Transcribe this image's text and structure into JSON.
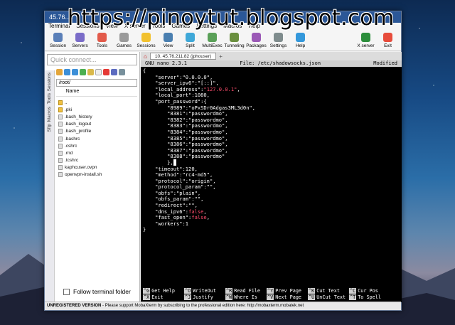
{
  "watermark": "https://pinoytut.blogspot.com",
  "window": {
    "title": "45.76.…"
  },
  "menu": [
    "Terminal",
    "Sessions",
    "View",
    "X server",
    "Tools",
    "Games",
    "Settings",
    "Macros",
    "Help"
  ],
  "toolbar": [
    "Session",
    "Servers",
    "Tools",
    "Games",
    "Sessions",
    "View",
    "Split",
    "MultiExec",
    "Tunneling",
    "Packages",
    "Settings",
    "Help",
    "X server",
    "Exit"
  ],
  "sidebar": {
    "quick_connect": "Quick connect...",
    "tabs": [
      "Sessions",
      "Tools",
      "Macros",
      "Sftp"
    ],
    "path": "/root/",
    "name_header": "Name",
    "files": [
      "..",
      ".pki",
      ".bash_history",
      ".bash_logout",
      ".bash_profile",
      ".bashrc",
      ".cshrc",
      ".rnd",
      ".tcshrc",
      "kaphcuser.ovpn",
      "openvpn-install.sh"
    ],
    "follow": "Follow terminal folder"
  },
  "terminal": {
    "tab": "10. 45.76.211.82 (jphouser)",
    "nano_version": "GNU nano 2.3.1",
    "file": "File: /etc/shadowsocks.json",
    "state": "Modified",
    "lines": [
      "{",
      "    \"server\":\"0.0.0.0\",",
      "    \"server_ipv6\":\"[::]\",",
      "    \"local_address\":\"127.0.0.1\",",
      "    \"local_port\":1080,",
      "    \"port_password\":{",
      "        \"8989\":\"oPxSDr0Adgas3ML3d0n\",",
      "        \"8381\":\"passwordmo\",",
      "        \"8382\":\"passwordmo\",",
      "        \"8383\":\"passwordmo\",",
      "        \"8384\":\"passwordmo\",",
      "        \"8385\":\"passwordmo\",",
      "        \"8386\":\"passwordmo\",",
      "        \"8387\":\"passwordmo\",",
      "        \"8388\":\"passwordmo\"",
      "        },",
      "    \"timeout\":120,",
      "    \"method\":\"rc4-md5\",",
      "    \"protocol\":\"origin\",",
      "    \"protocol_param\":\"\",",
      "    \"obfs\":\"plain\",",
      "    \"obfs_param\":\"\",",
      "    \"redirect\":\"\",",
      "    \"dns_ipv6\":false,",
      "    \"fast_open\":false,",
      "    \"workers\":1",
      "}"
    ],
    "shortcuts_row1": [
      [
        "^G",
        "Get Help"
      ],
      [
        "^O",
        "WriteOut"
      ],
      [
        "^R",
        "Read File"
      ],
      [
        "^Y",
        "Prev Page"
      ],
      [
        "^K",
        "Cut Text"
      ],
      [
        "^C",
        "Cur Pos"
      ]
    ],
    "shortcuts_row2": [
      [
        "^X",
        "Exit"
      ],
      [
        "^J",
        "Justify"
      ],
      [
        "^W",
        "Where Is"
      ],
      [
        "^V",
        "Next Page"
      ],
      [
        "^U",
        "UnCut Text"
      ],
      [
        "^T",
        "To Spell"
      ]
    ]
  },
  "status": {
    "label": "UNREGISTERED VERSION",
    "text": " -  Please support MobaXterm by subscribing to the professional edition here:  http://mobaxterm.mobatek.net"
  }
}
